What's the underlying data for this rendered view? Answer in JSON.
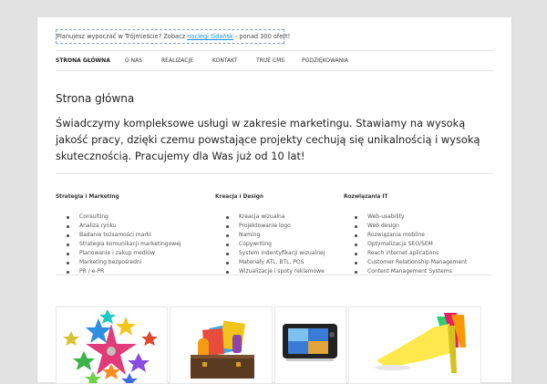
{
  "promo": {
    "prefix": "Planujesz wypoczać w Trójmieście? Zobacz",
    "link": "noclegi Gdańsk",
    "suffix": "- ponad 300 ofert!"
  },
  "nav": {
    "items": [
      {
        "label": "STRONA GŁÓWNA",
        "active": true
      },
      {
        "label": "O NAS"
      },
      {
        "label": "REALIZACJE"
      },
      {
        "label": "KONTAKT"
      },
      {
        "label": "TRUE CMS"
      },
      {
        "label": "PODZIĘKOWANIA"
      }
    ]
  },
  "content": {
    "title": "Strona główna",
    "intro": "Świadczymy kompleksowe usługi w zakresie marketingu. Stawiamy na wysoką jakość pracy, dzięki czemu powstające projekty cechują się unikalnością i wysoką skutecznością. Pracujemy dla Was już od 10 lat!"
  },
  "columns": [
    {
      "heading": "Strategia i Marketing",
      "items": [
        "Consulting",
        "Analiza rynku",
        "Badanie tożsamości marki",
        "Strategia komunikacji marketingowej",
        "Planowanie i zakup mediów",
        "Marketing bezpośredni",
        "PR / e-PR"
      ]
    },
    {
      "heading": "Kreacja i Design",
      "items": [
        "Kreacja wizualna",
        "Projektowanie logo",
        "Naming",
        "Copywriting",
        "System indentyfikacji wizualnej",
        "Materiały ATL, BTL, POS",
        "Wizualizacje i spoty reklamowe"
      ]
    },
    {
      "heading": "Rozwiązania IT",
      "items": [
        "Web-usability",
        "Web design",
        "Rozwiązania mobilne",
        "Optymalizacja SEO/SEM",
        "Reach internet aplications",
        "Customer Relationship Management",
        "Content Management Systems"
      ]
    }
  ],
  "colors": {
    "page_bg": "#e2e2e2",
    "content_bg": "#ffffff",
    "link": "#1b8be0",
    "text": "#373737"
  },
  "images": [
    {
      "name": "colorful-stars-image"
    },
    {
      "name": "suitcase-with-documents-image"
    },
    {
      "name": "camera-device-image"
    },
    {
      "name": "colorful-high-heels-image"
    }
  ]
}
